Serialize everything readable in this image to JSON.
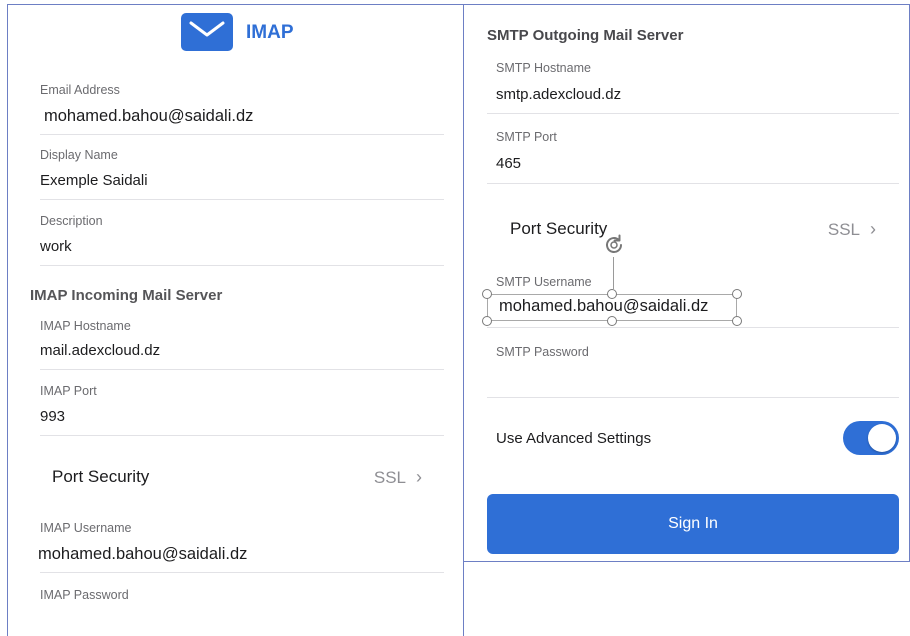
{
  "left": {
    "header": {
      "title": "IMAP",
      "icon": "mail-envelope-icon"
    },
    "email": {
      "label": "Email Address",
      "value": "mohamed.bahou@saidali.dz"
    },
    "display_name": {
      "label": "Display Name",
      "value": "Exemple Saidali"
    },
    "description": {
      "label": "Description",
      "value": "work"
    },
    "imap_section": "IMAP Incoming Mail Server",
    "imap_hostname": {
      "label": "IMAP Hostname",
      "value": "mail.adexcloud.dz"
    },
    "imap_port": {
      "label": "IMAP Port",
      "value": "993"
    },
    "port_security": {
      "label": "Port Security",
      "value": "SSL"
    },
    "imap_username": {
      "label": "IMAP Username",
      "value": "mohamed.bahou@saidali.dz"
    },
    "imap_password": {
      "label": "IMAP Password",
      "value": ""
    }
  },
  "right": {
    "smtp_section": "SMTP Outgoing Mail Server",
    "smtp_hostname": {
      "label": "SMTP Hostname",
      "value": "smtp.adexcloud.dz"
    },
    "smtp_port": {
      "label": "SMTP Port",
      "value": "465"
    },
    "port_security": {
      "label": "Port Security",
      "value": "SSL"
    },
    "smtp_username": {
      "label": "SMTP Username",
      "value": "mohamed.bahou@saidali.dz"
    },
    "smtp_password": {
      "label": "SMTP Password",
      "value": ""
    },
    "advanced": {
      "label": "Use Advanced Settings",
      "enabled": true
    },
    "sign_in": "Sign In"
  },
  "colors": {
    "accent": "#2f6fd6",
    "panel_border": "#6d7fc4",
    "separator": "#e2e2e6"
  }
}
